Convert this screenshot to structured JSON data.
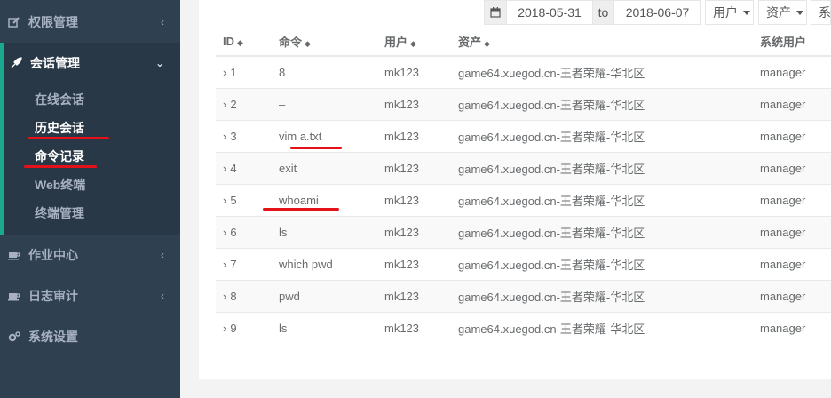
{
  "sidebar": {
    "items": [
      {
        "label": "权限管理",
        "icon": "edit-icon",
        "chevron": "‹"
      },
      {
        "label": "会话管理",
        "icon": "rocket-icon",
        "chevron": "⌄"
      },
      {
        "label": "作业中心",
        "icon": "coffee-icon",
        "chevron": "‹"
      },
      {
        "label": "日志审计",
        "icon": "coffee-icon",
        "chevron": "‹"
      },
      {
        "label": "系统设置",
        "icon": "gears-icon",
        "chevron": ""
      }
    ],
    "submenu": [
      "在线会话",
      "历史会话",
      "命令记录",
      "Web终端",
      "终端管理"
    ]
  },
  "filters": {
    "date_from": "2018-05-31",
    "to_label": "to",
    "date_to": "2018-06-07",
    "user_select": "用户",
    "asset_select": "资产",
    "system_select": "系统"
  },
  "table": {
    "headers": [
      "ID",
      "命令",
      "用户",
      "资产",
      "系统用户"
    ],
    "rows": [
      {
        "id": "1",
        "command": "8",
        "user": "mk123",
        "asset": "game64.xuegod.cn-王者荣耀-华北区",
        "system_user": "manager"
      },
      {
        "id": "2",
        "command": "–",
        "user": "mk123",
        "asset": "game64.xuegod.cn-王者荣耀-华北区",
        "system_user": "manager"
      },
      {
        "id": "3",
        "command": "vim a.txt",
        "user": "mk123",
        "asset": "game64.xuegod.cn-王者荣耀-华北区",
        "system_user": "manager"
      },
      {
        "id": "4",
        "command": "exit",
        "user": "mk123",
        "asset": "game64.xuegod.cn-王者荣耀-华北区",
        "system_user": "manager"
      },
      {
        "id": "5",
        "command": "whoami",
        "user": "mk123",
        "asset": "game64.xuegod.cn-王者荣耀-华北区",
        "system_user": "manager"
      },
      {
        "id": "6",
        "command": "ls",
        "user": "mk123",
        "asset": "game64.xuegod.cn-王者荣耀-华北区",
        "system_user": "manager"
      },
      {
        "id": "7",
        "command": "which pwd",
        "user": "mk123",
        "asset": "game64.xuegod.cn-王者荣耀-华北区",
        "system_user": "manager"
      },
      {
        "id": "8",
        "command": "pwd",
        "user": "mk123",
        "asset": "game64.xuegod.cn-王者荣耀-华北区",
        "system_user": "manager"
      },
      {
        "id": "9",
        "command": "ls",
        "user": "mk123",
        "asset": "game64.xuegod.cn-王者荣耀-华北区",
        "system_user": "manager"
      }
    ]
  },
  "colors": {
    "sidebar_bg": "#2f4050",
    "sidebar_active": "#293846",
    "accent": "#19aa8d",
    "annotation": "#e4111b"
  }
}
